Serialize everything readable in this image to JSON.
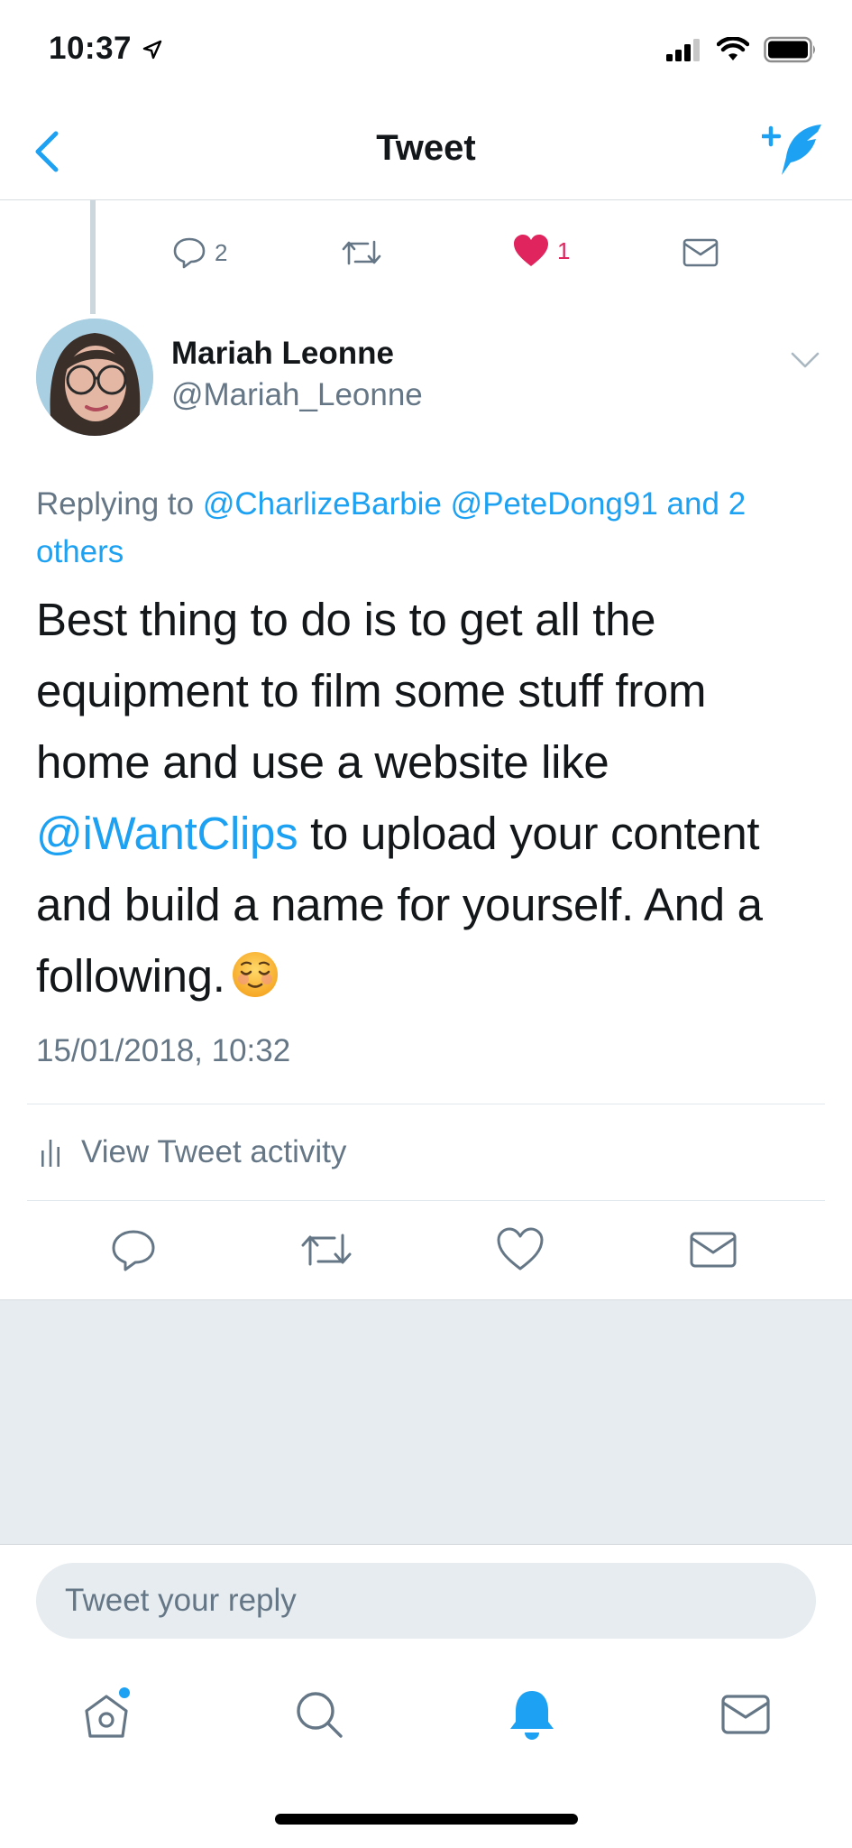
{
  "status_bar": {
    "time": "10:37"
  },
  "nav": {
    "title": "Tweet"
  },
  "prev_tweet": {
    "reply_count": "2",
    "like_count": "1"
  },
  "tweet": {
    "author_name": "Mariah Leonne",
    "author_handle": "@Mariah_Leonne",
    "replying_label": "Replying to",
    "replying_mentions": [
      "@CharlizeBarbie",
      "@PeteDong91",
      "and",
      "2 others"
    ],
    "body_part1": "Best thing to do is to get all the equipment to film some stuff from home and use a website like ",
    "body_mention": "@iWantClips",
    "body_part2": " to upload your content and build a name for yourself. And a following.",
    "emoji": "relieved-face",
    "timestamp": "15/01/2018, 10:32",
    "activity_label": "View Tweet activity"
  },
  "reply": {
    "placeholder": "Tweet your reply"
  },
  "colors": {
    "accent": "#1da1f2",
    "like": "#e0245e",
    "secondary_text": "#657786",
    "background_gray": "#e6ecf0"
  },
  "icons": {
    "tabs": [
      "home-icon",
      "search-icon",
      "notifications-bell-icon",
      "messages-icon"
    ]
  }
}
